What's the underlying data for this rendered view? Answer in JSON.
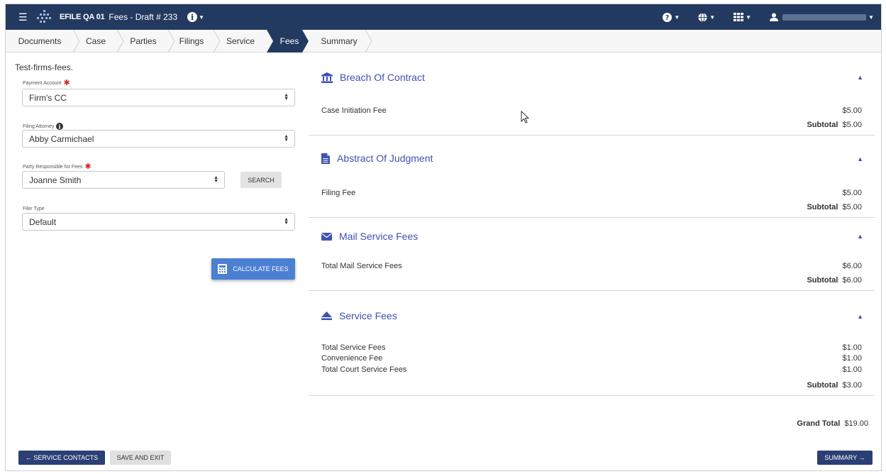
{
  "header": {
    "app_name": "EFILE QA 01",
    "doc_title": "Fees - Draft # 233"
  },
  "steps": [
    {
      "label": "Documents"
    },
    {
      "label": "Case"
    },
    {
      "label": "Parties"
    },
    {
      "label": "Filings"
    },
    {
      "label": "Service"
    },
    {
      "label": "Fees",
      "active": true
    },
    {
      "label": "Summary"
    }
  ],
  "form": {
    "firm": "Test-firms-fees.",
    "payment_account": {
      "label": "Payment Account",
      "value": "Firm's CC"
    },
    "filing_attorney": {
      "label": "Filing Attorney",
      "value": "Abby Carmichael"
    },
    "party_responsible": {
      "label": "Party Responsible for Fees",
      "value": "Joanne Smith"
    },
    "search_label": "SEARCH",
    "filer_type": {
      "label": "Filer Type",
      "value": "Default"
    },
    "calculate_label": "CALCULATE FEES"
  },
  "sections": [
    {
      "title": "Breach Of Contract",
      "icon": "bank-icon",
      "rows": [
        {
          "name": "Case Initiation Fee",
          "amount": "$5.00"
        }
      ],
      "subtotal": "$5.00"
    },
    {
      "title": "Abstract Of Judgment",
      "icon": "document-icon",
      "rows": [
        {
          "name": "Filing Fee",
          "amount": "$5.00"
        }
      ],
      "subtotal": "$5.00"
    },
    {
      "title": "Mail Service Fees",
      "icon": "envelope-icon",
      "rows": [
        {
          "name": "Total Mail Service Fees",
          "amount": "$6.00"
        }
      ],
      "subtotal": "$6.00"
    },
    {
      "title": "Service Fees",
      "icon": "eject-icon",
      "rows": [
        {
          "name": "Total Service Fees",
          "amount": "$1.00"
        },
        {
          "name": "Convenience Fee",
          "amount": "$1.00"
        },
        {
          "name": "Total Court Service Fees",
          "amount": "$1.00"
        }
      ],
      "subtotal": "$3.00"
    }
  ],
  "subtotal_label": "Subtotal",
  "grand_total": {
    "label": "Grand Total",
    "value": "$19.00"
  },
  "footer": {
    "service_contacts": "← SERVICE CONTACTS",
    "save_exit": "SAVE AND EXIT",
    "summary": "SUMMARY →"
  },
  "colors": {
    "header_bg": "#233a60",
    "accent": "#3f51b5",
    "calc_button": "#4a7fd4",
    "required": "#d9262f"
  }
}
